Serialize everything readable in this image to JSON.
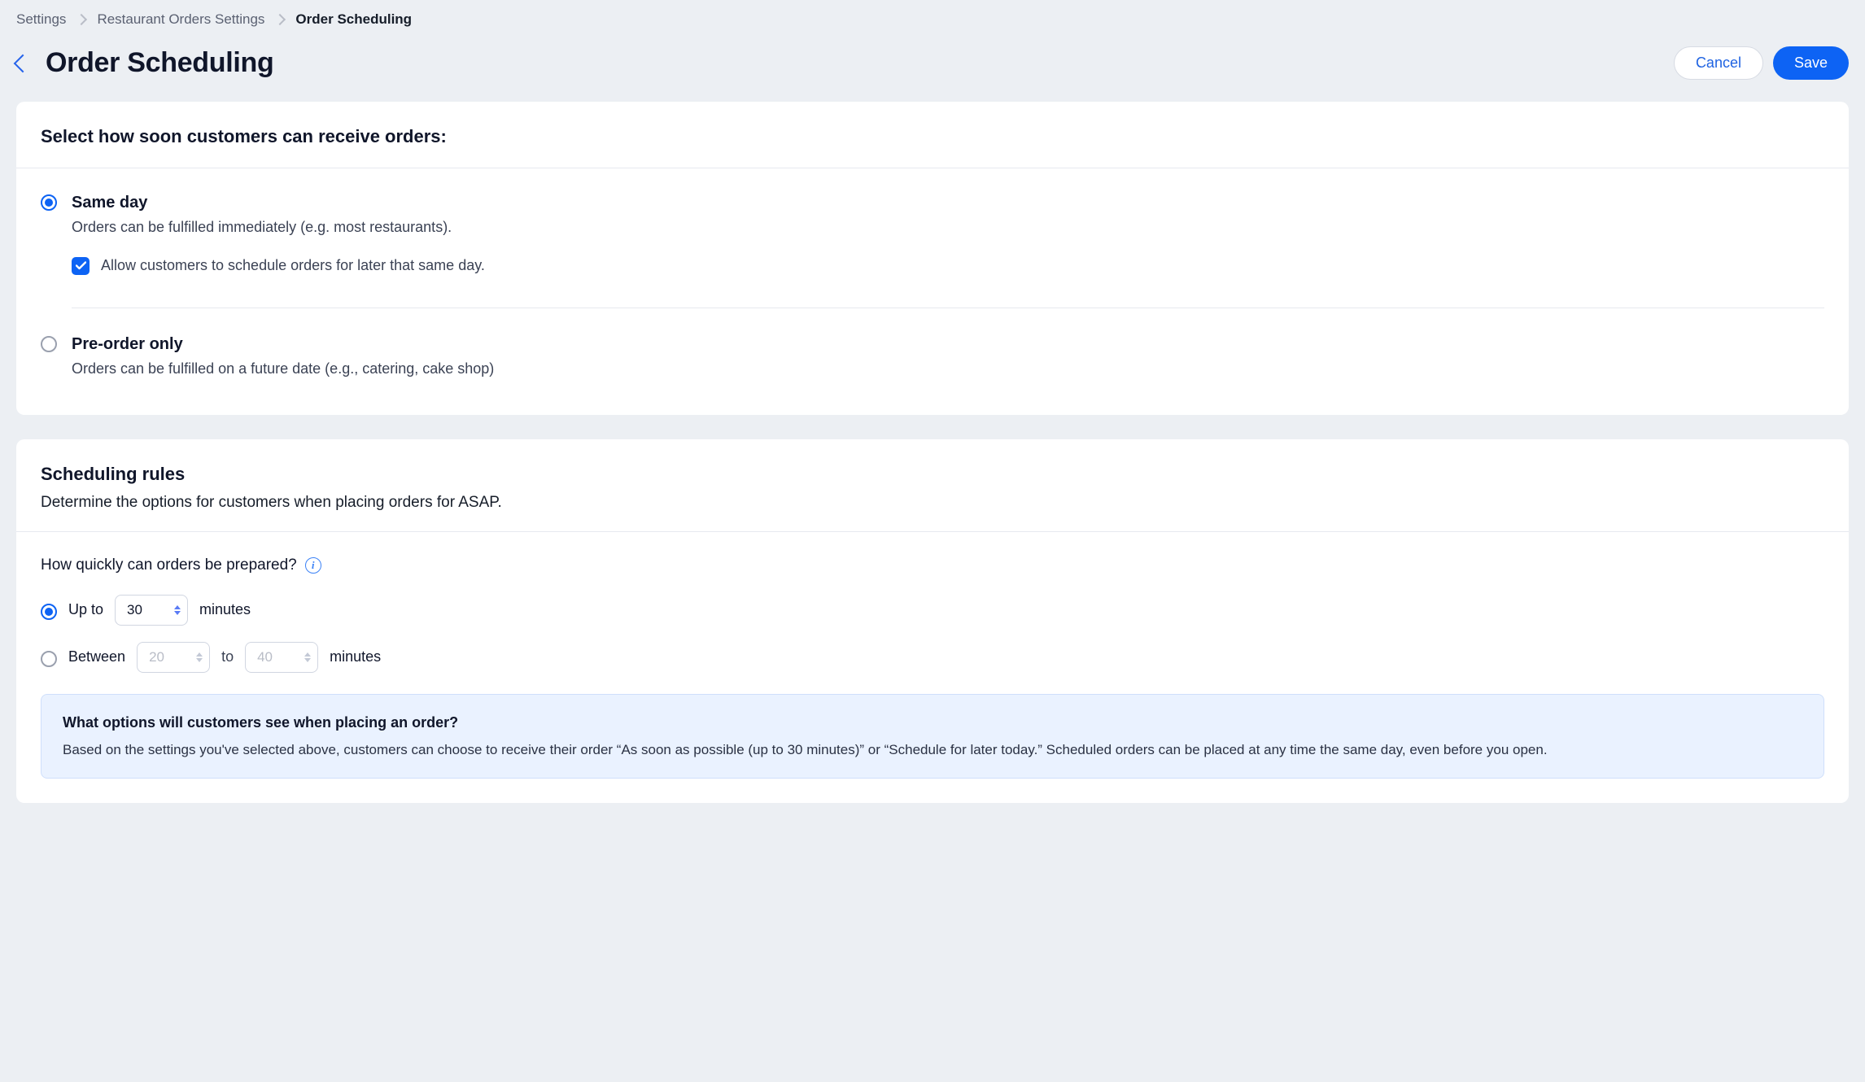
{
  "breadcrumb": {
    "items": [
      {
        "label": "Settings",
        "current": false
      },
      {
        "label": "Restaurant Orders Settings",
        "current": false
      },
      {
        "label": "Order Scheduling",
        "current": true
      }
    ]
  },
  "header": {
    "title": "Order Scheduling",
    "cancel_label": "Cancel",
    "save_label": "Save"
  },
  "receive": {
    "section_title": "Select how soon customers can receive orders:",
    "options": [
      {
        "title": "Same day",
        "desc": "Orders can be fulfilled immediately (e.g. most restaurants).",
        "selected": true,
        "allow_schedule_label": "Allow customers to schedule orders for later that same day.",
        "allow_schedule_checked": true
      },
      {
        "title": "Pre-order only",
        "desc": "Orders can be fulfilled on a future date (e.g., catering, cake shop)",
        "selected": false
      }
    ]
  },
  "rules": {
    "section_title": "Scheduling rules",
    "section_subtitle": "Determine the options for customers when placing orders for ASAP.",
    "prep_question": "How quickly can orders be prepared?",
    "upto": {
      "selected": true,
      "label_prefix": "Up to",
      "value": "30",
      "label_suffix": "minutes"
    },
    "between": {
      "selected": false,
      "label_prefix": "Between",
      "min_value": "20",
      "mid_label": "to",
      "max_value": "40",
      "label_suffix": "minutes"
    },
    "preview_question": "What options will customers see when placing an order?",
    "preview_text": "Based on the settings you've selected above, customers can choose to receive their order “As soon as possible (up to 30 minutes)” or “Schedule for later today.” Scheduled orders can be placed at any time the same day, even before you open."
  }
}
